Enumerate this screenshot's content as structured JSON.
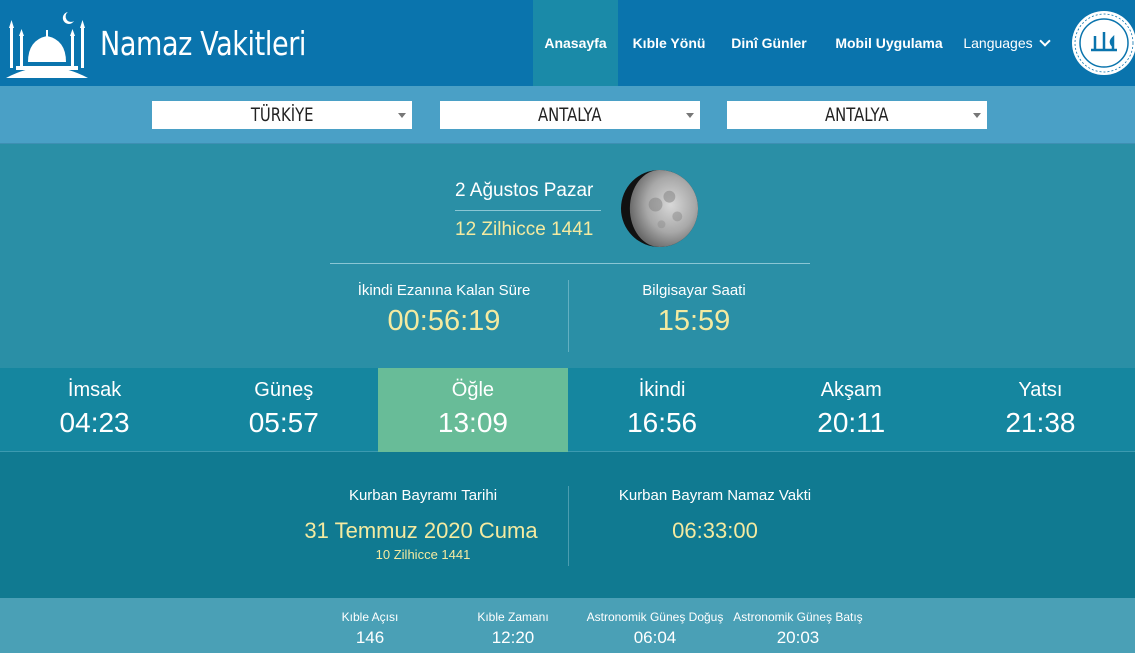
{
  "header": {
    "brand": "Namaz Vakitleri",
    "nav": [
      "Anasayfa",
      "Kıble Yönü",
      "Dinî Günler",
      "Mobil Uygulama"
    ],
    "languages": "Languages"
  },
  "selectors": {
    "country": "TÜRKİYE",
    "city": "ANTALYA",
    "district": "ANTALYA"
  },
  "date": {
    "gregorian": "2 Ağustos Pazar",
    "hijri": "12 Zilhicce 1441"
  },
  "countdown": {
    "label": "İkindi Ezanına Kalan Süre",
    "value": "00:56:19"
  },
  "clock": {
    "label": "Bilgisayar Saati",
    "value": "15:59"
  },
  "prayers": [
    {
      "name": "İmsak",
      "time": "04:23"
    },
    {
      "name": "Güneş",
      "time": "05:57"
    },
    {
      "name": "Öğle",
      "time": "13:09"
    },
    {
      "name": "İkindi",
      "time": "16:56"
    },
    {
      "name": "Akşam",
      "time": "20:11"
    },
    {
      "name": "Yatsı",
      "time": "21:38"
    }
  ],
  "kurban": {
    "date_label": "Kurban Bayramı Tarihi",
    "date_value": "31 Temmuz 2020 Cuma",
    "date_hijri": "10 Zilhicce 1441",
    "prayer_label": "Kurban Bayram Namaz Vakti",
    "prayer_value": "06:33:00"
  },
  "qibla": [
    {
      "label": "Kıble Açısı",
      "value": "146"
    },
    {
      "label": "Kıble Zamanı",
      "value": "12:20"
    },
    {
      "label": "Astronomik Güneş Doğuş",
      "value": "06:04"
    },
    {
      "label": "Astronomik Güneş Batış",
      "value": "20:03"
    }
  ],
  "colors": {
    "header": "#0a74ad",
    "accent_text": "#f4eaa0",
    "active_prayer": "#68bc98"
  }
}
